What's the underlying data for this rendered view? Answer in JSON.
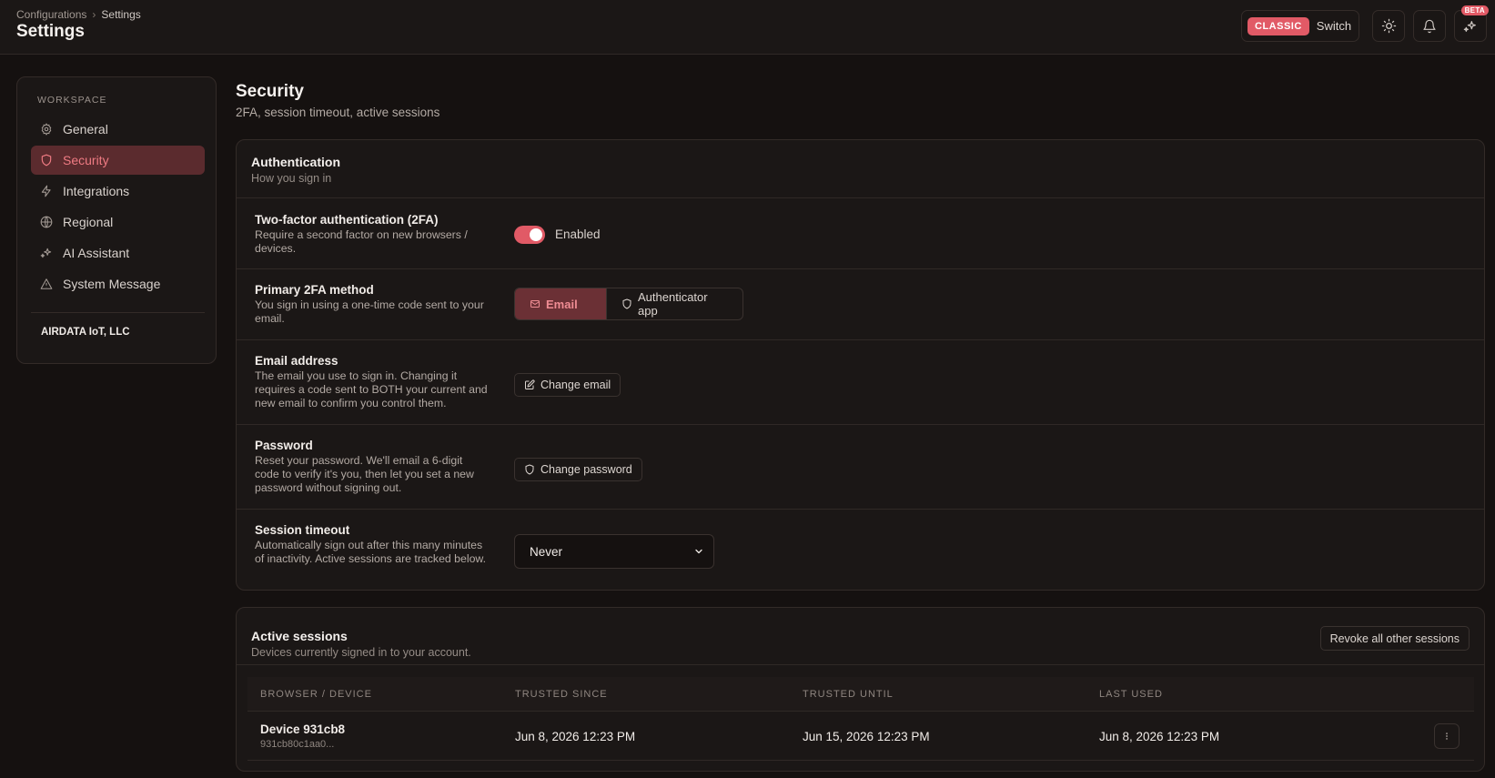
{
  "header": {
    "breadcrumb": [
      "Configurations",
      "Settings"
    ],
    "title": "Settings",
    "mode_badge": "CLASSIC",
    "switch_label": "Switch",
    "beta_badge": "BETA",
    "icons": [
      "sun-icon",
      "bell-icon",
      "sparkle-icon"
    ]
  },
  "sidebar": {
    "heading": "WORKSPACE",
    "items": [
      {
        "label": "General",
        "icon": "gear-icon",
        "active": false
      },
      {
        "label": "Security",
        "icon": "shield-icon",
        "active": true
      },
      {
        "label": "Integrations",
        "icon": "bolt-icon",
        "active": false
      },
      {
        "label": "Regional",
        "icon": "globe-icon",
        "active": false
      },
      {
        "label": "AI Assistant",
        "icon": "sparkle-icon",
        "active": false
      },
      {
        "label": "System Message",
        "icon": "warning-icon",
        "active": false
      }
    ],
    "org_name": "AIRDATA IoT, LLC"
  },
  "section": {
    "title": "Security",
    "subtitle": "2FA, session timeout, active sessions"
  },
  "auth_card": {
    "title": "Authentication",
    "subtitle": "How you sign in",
    "two_factor": {
      "title": "Two-factor authentication (2FA)",
      "description": "Require a second factor on new browsers / devices.",
      "toggle_label": "Enabled",
      "enabled": true
    },
    "primary_method": {
      "title": "Primary 2FA method",
      "description": "You sign in using a one-time code sent to your email.",
      "options": [
        "Email",
        "Authenticator app"
      ],
      "selected": "Email"
    },
    "email": {
      "title": "Email address",
      "description": "The email you use to sign in. Changing it requires a code sent to BOTH your current and new email to confirm you control them.",
      "button": "Change email"
    },
    "password": {
      "title": "Password",
      "description": "Reset your password. We'll email a 6-digit code to verify it's you, then let you set a new password without signing out.",
      "button": "Change password"
    },
    "session_timeout": {
      "title": "Session timeout",
      "description": "Automatically sign out after this many minutes of inactivity. Active sessions are tracked below.",
      "value": "Never"
    }
  },
  "sessions_card": {
    "title": "Active sessions",
    "subtitle": "Devices currently signed in to your account.",
    "revoke_button": "Revoke all other sessions",
    "columns": [
      "BROWSER / DEVICE",
      "TRUSTED SINCE",
      "TRUSTED UNTIL",
      "LAST USED"
    ],
    "rows": [
      {
        "device": "Device 931cb8",
        "device_id": "931cb80c1aa0...",
        "trusted_since": "Jun 8, 2026 12:23 PM",
        "trusted_until": "Jun 15, 2026 12:23 PM",
        "last_used": "Jun 8, 2026 12:23 PM"
      }
    ]
  },
  "colors": {
    "accent": "#e15a66",
    "background": "#151110",
    "card": "#1b1716",
    "active_nav_bg": "#5b2b2e"
  }
}
